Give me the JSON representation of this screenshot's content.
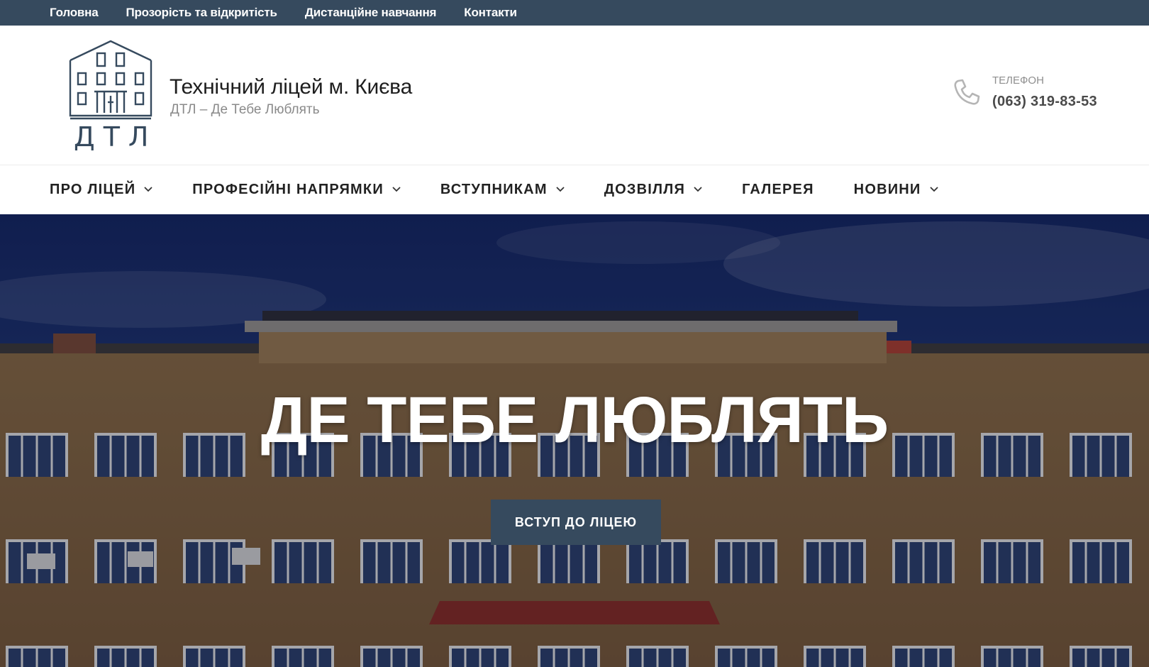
{
  "topbar": {
    "links": [
      "Головна",
      "Прозорість та відкритість",
      "Дистанційне навчання",
      "Контакти"
    ]
  },
  "header": {
    "logo_text": "ДТЛ",
    "title": "Технічний ліцей м. Києва",
    "tagline": "ДТЛ – Де Тебе Люблять",
    "phone_label": "Телефон",
    "phone_number": "(063) 319-83-53"
  },
  "nav": {
    "items": [
      {
        "label": "ПРО ЛІЦЕЙ",
        "has_dropdown": true
      },
      {
        "label": "ПРОФЕСІЙНІ НАПРЯМКИ",
        "has_dropdown": true
      },
      {
        "label": "ВСТУПНИКАМ",
        "has_dropdown": true
      },
      {
        "label": "ДОЗВІЛЛЯ",
        "has_dropdown": true
      },
      {
        "label": "ГАЛЕРЕЯ",
        "has_dropdown": false
      },
      {
        "label": "НОВИНИ",
        "has_dropdown": true
      }
    ]
  },
  "hero": {
    "title": "ДЕ ТЕБЕ ЛЮБЛЯТЬ",
    "button_label": "ВСТУП ДО ЛІЦЕЮ"
  },
  "colors": {
    "topbar_bg": "#364a5e",
    "button_bg": "#364a5e",
    "sky": "#1a2a66",
    "brick": "#a8865a"
  }
}
